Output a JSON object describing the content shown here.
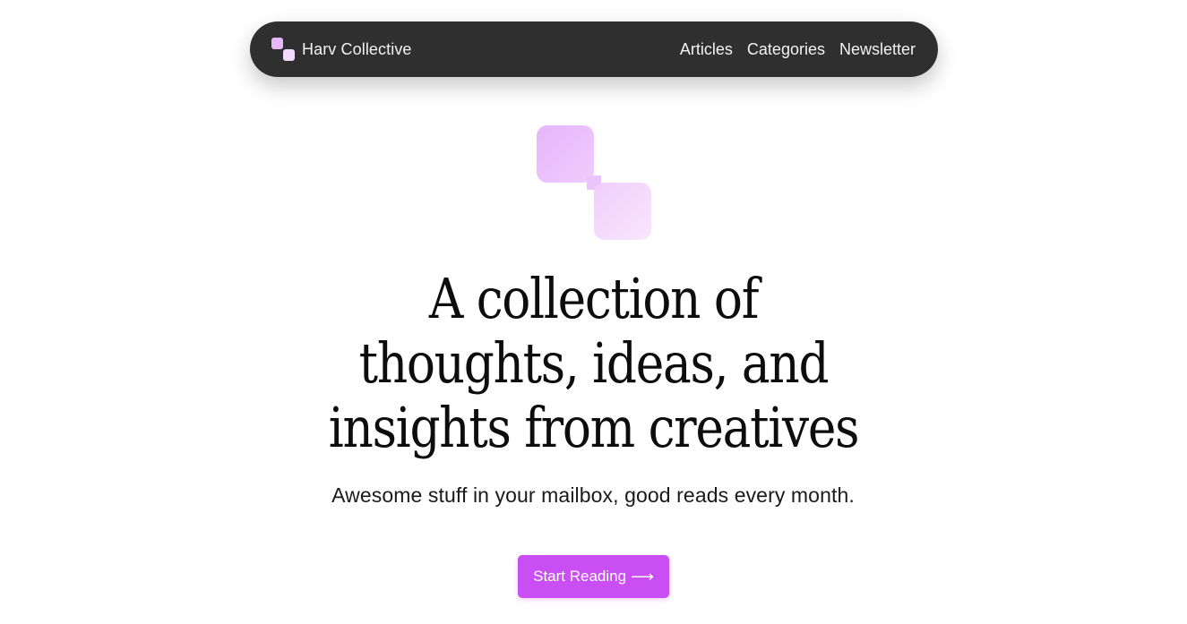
{
  "nav": {
    "brand": "Harv Collective",
    "links": [
      "Articles",
      "Categories",
      "Newsletter"
    ]
  },
  "hero": {
    "headline_lines": [
      "A collection of",
      "thoughts, ideas, and",
      "insights from creatives"
    ],
    "subtitle": "Awesome stuff in your mailbox, good reads every month.",
    "cta_label": "Start Reading",
    "cta_icon": "arrow-right-icon"
  },
  "colors": {
    "navbar_bg": "#2f2f2f",
    "accent": "#c94ff5",
    "logo_light": "#f5d9fc",
    "logo_dark": "#e5b9f7"
  }
}
